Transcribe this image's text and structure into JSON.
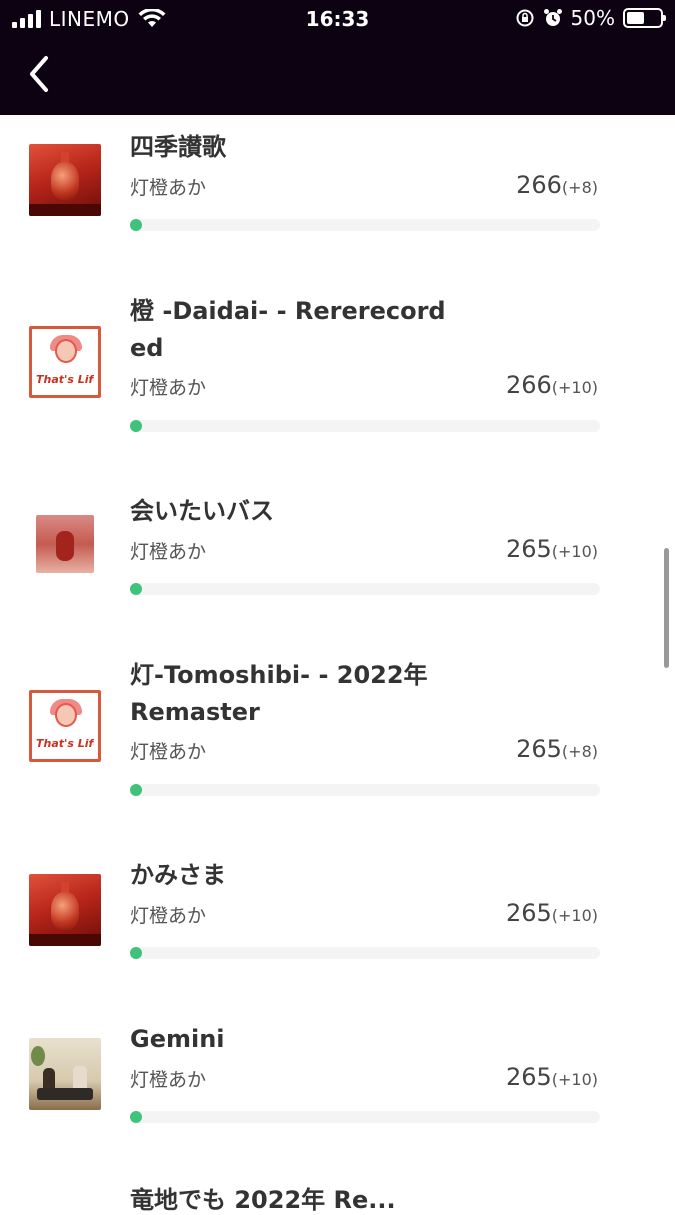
{
  "status_bar": {
    "carrier": "LINEMO",
    "time": "16:33",
    "battery": "50%"
  },
  "items": [
    {
      "title": "四季讃歌",
      "artist": "灯橙あか",
      "score": "266",
      "delta": "(+8)",
      "art": "red-vase"
    },
    {
      "title": "橙 -Daidai- - Rererecorded",
      "artist": "灯橙あか",
      "score": "266",
      "delta": "(+10)",
      "art": "white-portrait"
    },
    {
      "title": "会いたいバス",
      "artist": "灯橙あか",
      "score": "265",
      "delta": "(+10)",
      "art": "small-red"
    },
    {
      "title": "灯-Tomoshibi- - 2022年 Remaster",
      "artist": "灯橙あか",
      "score": "265",
      "delta": "(+8)",
      "art": "white-portrait"
    },
    {
      "title": "かみさま",
      "artist": "灯橙あか",
      "score": "265",
      "delta": "(+10)",
      "art": "red-vase"
    },
    {
      "title": "Gemini",
      "artist": "灯橙あか",
      "score": "265",
      "delta": "(+10)",
      "art": "room-photo"
    }
  ],
  "partial_item": {
    "title": "竜地でも 2022年 Re..."
  },
  "art_logo_text": "That's Lifelling",
  "colors": {
    "header": "#0d0211",
    "progress_dot": "#3fc37a",
    "track": "#f4f4f4",
    "art_accent": "#d9583c"
  }
}
